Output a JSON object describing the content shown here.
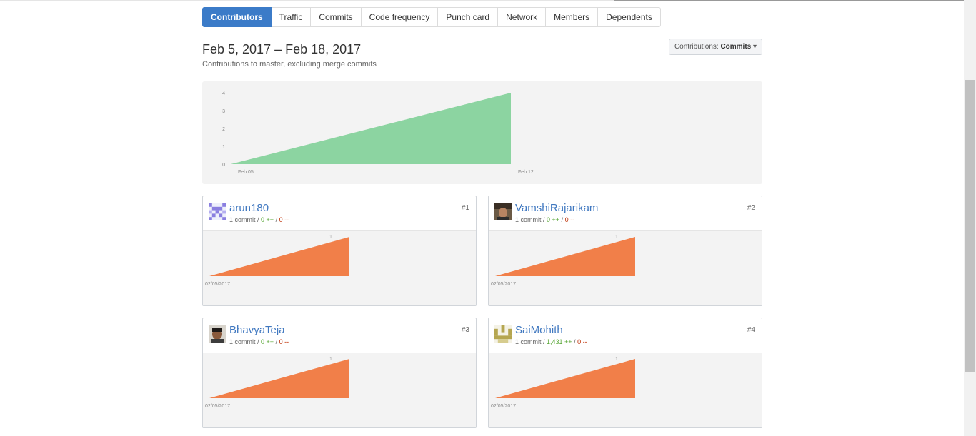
{
  "tabs": [
    {
      "label": "Contributors",
      "active": true
    },
    {
      "label": "Traffic"
    },
    {
      "label": "Commits"
    },
    {
      "label": "Code frequency"
    },
    {
      "label": "Punch card"
    },
    {
      "label": "Network"
    },
    {
      "label": "Members"
    },
    {
      "label": "Dependents"
    }
  ],
  "header": {
    "date_range": "Feb 5, 2017 – Feb 18, 2017",
    "subtitle": "Contributions to master, excluding merge commits",
    "dropdown_prefix": "Contributions:",
    "dropdown_value": "Commits"
  },
  "colors": {
    "accent": "#3b7bc8",
    "main_area": "#8cd4a1",
    "contrib_area": "#f17f49"
  },
  "chart_data": {
    "type": "area",
    "x": [
      "Feb 05",
      "Feb 12"
    ],
    "values": [
      0,
      4
    ],
    "yticks": [
      "0",
      "1",
      "2",
      "3",
      "4"
    ],
    "xticks": [
      "Feb 05",
      "Feb 12"
    ],
    "ylim": [
      0,
      4
    ]
  },
  "contributors": [
    {
      "name": "arun180",
      "rank": "#1",
      "commits": "1 commit",
      "additions": "0 ++",
      "deletions": "0 --",
      "avatar": "identicon-purple",
      "chart_start": "02/05/2017",
      "chart_peak_label": "1",
      "values": [
        0,
        1
      ]
    },
    {
      "name": "VamshiRajarikam",
      "rank": "#2",
      "commits": "1 commit",
      "additions": "0 ++",
      "deletions": "0 --",
      "avatar": "photo-person",
      "chart_start": "02/05/2017",
      "chart_peak_label": "1",
      "values": [
        0,
        1
      ]
    },
    {
      "name": "BhavyaTeja",
      "rank": "#3",
      "commits": "1 commit",
      "additions": "0 ++",
      "deletions": "0 --",
      "avatar": "photo-person",
      "chart_start": "02/05/2017",
      "chart_peak_label": "1",
      "values": [
        0,
        1
      ]
    },
    {
      "name": "SaiMohith",
      "rank": "#4",
      "commits": "1 commit",
      "additions": "1,431 ++",
      "deletions": "0 --",
      "avatar": "identicon-olive",
      "chart_start": "02/05/2017",
      "chart_peak_label": "1",
      "values": [
        0,
        1
      ]
    }
  ]
}
